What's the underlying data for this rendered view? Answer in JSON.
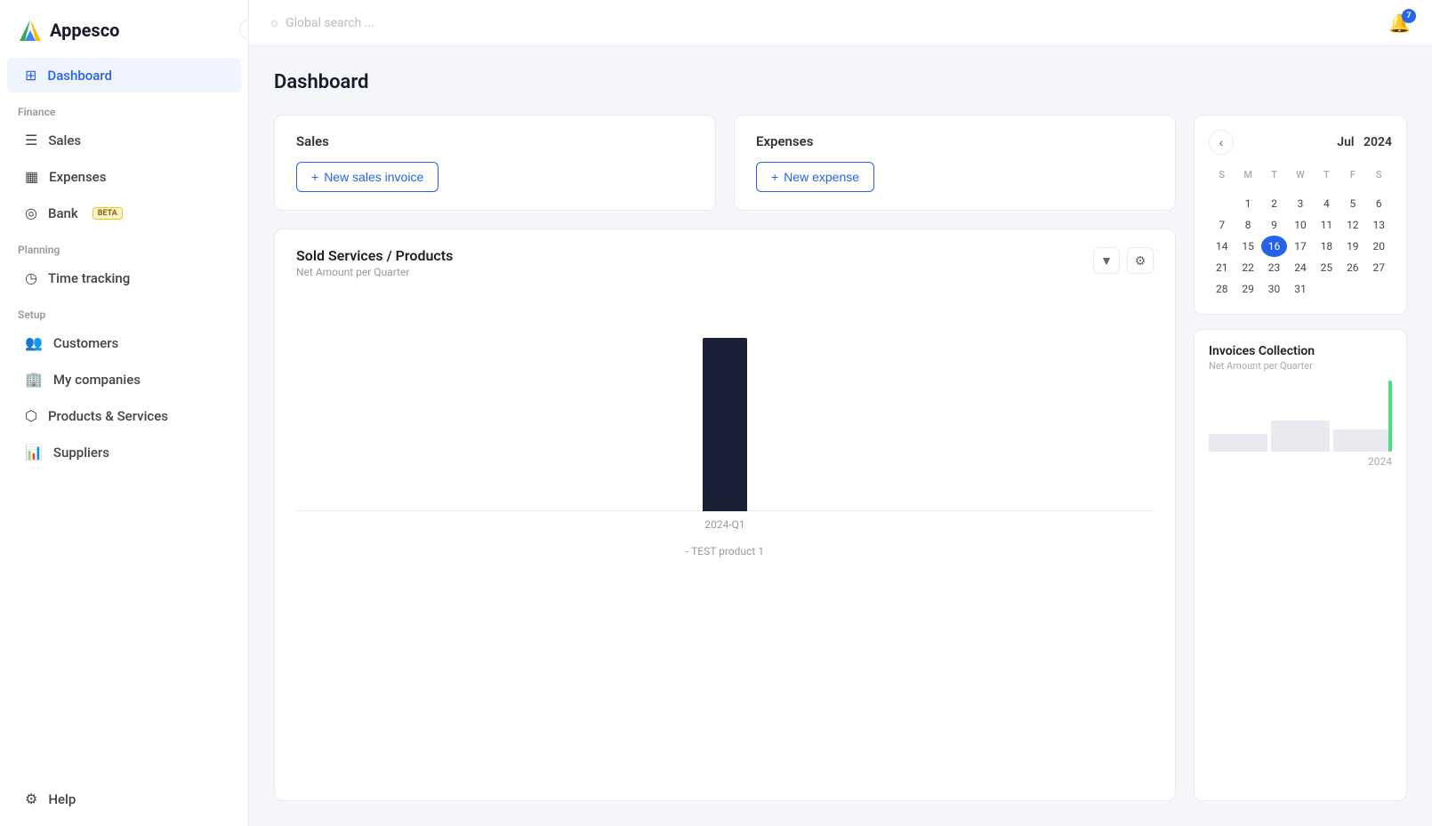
{
  "app": {
    "name": "Appesco"
  },
  "sidebar": {
    "collapse_label": "‹",
    "nav": {
      "dashboard_label": "Dashboard",
      "finance_section": "Finance",
      "sales_label": "Sales",
      "expenses_label": "Expenses",
      "bank_label": "Bank",
      "bank_badge": "BETA",
      "planning_section": "Planning",
      "time_tracking_label": "Time tracking",
      "setup_section": "Setup",
      "customers_label": "Customers",
      "my_companies_label": "My companies",
      "products_services_label": "Products & Services",
      "suppliers_label": "Suppliers",
      "help_label": "Help"
    }
  },
  "topbar": {
    "search_placeholder": "Global search ...",
    "notification_count": "7"
  },
  "page": {
    "title": "Dashboard"
  },
  "sales_card": {
    "label": "Sales",
    "button_label": "New sales invoice",
    "button_icon": "+"
  },
  "expenses_card": {
    "label": "Expenses",
    "button_label": "New expense",
    "button_icon": "+"
  },
  "chart": {
    "title": "Sold Services / Products",
    "subtitle": "Net Amount per Quarter",
    "filter_icon": "filter",
    "settings_icon": "gear",
    "bars": [
      {
        "quarter": "2024-Q1",
        "height_pct": 90
      }
    ],
    "x_label": "2024-Q1",
    "legend": "- TEST product 1"
  },
  "calendar": {
    "title": "Jul",
    "year": "2024",
    "prev_icon": "‹",
    "days_header": [
      "S",
      "M",
      "T",
      "W",
      "T",
      "F",
      "S"
    ],
    "weeks": [
      [
        "",
        "",
        "",
        "",
        "",
        "",
        ""
      ],
      [
        "",
        "1",
        "2",
        "3",
        "4",
        "5",
        "6"
      ],
      [
        "7",
        "8",
        "9",
        "10",
        "11",
        "12",
        "13"
      ],
      [
        "14",
        "15",
        "16",
        "17",
        "18",
        "19",
        "20"
      ],
      [
        "21",
        "22",
        "23",
        "24",
        "25",
        "26",
        "27"
      ],
      [
        "28",
        "29",
        "30",
        "31",
        "",
        "",
        ""
      ]
    ]
  },
  "invoices_collection": {
    "title": "Invoices Collection",
    "subtitle": "Net Amount per Quarter",
    "year_label": "2024"
  }
}
